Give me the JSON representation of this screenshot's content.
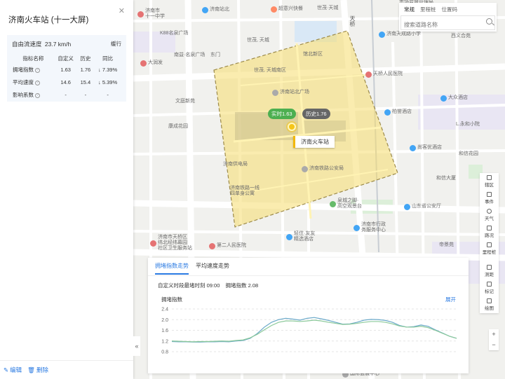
{
  "panel": {
    "title": "济南火车站 (十一大屏)",
    "free_flow_label": "自由流速度",
    "free_flow_value": "23.7 km/h",
    "slow_label": "缓行",
    "table": {
      "headers": [
        "指标名称",
        "自定义",
        "历史",
        "同比"
      ],
      "rows": [
        {
          "name": "拥堵指数",
          "custom": "1.63",
          "history": "1.76",
          "yoy": "↓ 7.39%"
        },
        {
          "name": "平均速度",
          "custom": "14.6",
          "history": "15.4",
          "yoy": "↓ 5.39%"
        },
        {
          "name": "影响系数",
          "custom": "-",
          "history": "-",
          "yoy": "-"
        }
      ]
    },
    "edit_label": "编辑",
    "delete_label": "删除"
  },
  "search": {
    "tabs": [
      "常规",
      "里程桩",
      "位置码"
    ],
    "placeholder": "搜索道路名称"
  },
  "map": {
    "road_labels": [
      "天桥"
    ],
    "pois": [
      {
        "name": "济南市\n十一中学",
        "color": "#e57373"
      },
      {
        "name": "济南站北",
        "color": "#42a5f5"
      },
      {
        "name": "超意兴快餐",
        "color": "#ff8a65"
      },
      {
        "name": "世茂·天城",
        "color": "#aaa"
      },
      {
        "name": "市场监督管理局",
        "color": "#aaa"
      },
      {
        "name": "济南天成路小学",
        "color": "#42a5f5"
      },
      {
        "name": "西义合苑",
        "color": "#aaa"
      },
      {
        "name": "K88名泉广场",
        "color": "#aaa"
      },
      {
        "name": "世茂, 天城",
        "color": "#aaa"
      },
      {
        "name": "馆北新区",
        "color": "#aaa"
      },
      {
        "name": "南益·名泉广场",
        "color": "#aaa"
      },
      {
        "name": "东门",
        "color": "#aaa"
      },
      {
        "name": "大润发",
        "color": "#e57373"
      },
      {
        "name": "世茂, 天城南区",
        "color": "#aaa"
      },
      {
        "name": "天桥人民医院",
        "color": "#e57373"
      },
      {
        "name": "济南站北广场",
        "color": "#aaa"
      },
      {
        "name": "大众酒店",
        "color": "#42a5f5"
      },
      {
        "name": "文庭新苑",
        "color": "#aaa"
      },
      {
        "name": "L.永和小院",
        "color": "#aaa"
      },
      {
        "name": "柏誉酒店",
        "color": "#42a5f5"
      },
      {
        "name": "康成花园",
        "color": "#aaa"
      },
      {
        "name": "尚客优酒店",
        "color": "#42a5f5"
      },
      {
        "name": "和信花园",
        "color": "#aaa"
      },
      {
        "name": "济南供电局",
        "color": "#aaa"
      },
      {
        "name": "济南铁路公安局",
        "color": "#aaa"
      },
      {
        "name": "和信大厦",
        "color": "#aaa"
      },
      {
        "name": "济南铁路一线\n四单身公寓",
        "color": "#aaa"
      },
      {
        "name": "泉城之脚·\n高空观景台",
        "color": "#66bb6a"
      },
      {
        "name": "山东省公安厅",
        "color": "#42a5f5"
      },
      {
        "name": "济南市行政\n务服务中心",
        "color": "#42a5f5"
      },
      {
        "name": "济南市天桥区\n纬北经纬幕园\n社区卫生服务站",
        "color": "#e57373"
      },
      {
        "name": "第二人民医院",
        "color": "#e57373"
      },
      {
        "name": "轻住·友友\n精选酒店",
        "color": "#42a5f5"
      },
      {
        "name": "帝景苑",
        "color": "#aaa"
      },
      {
        "name": "国际会展中心",
        "color": "#aaa"
      }
    ],
    "tag_now": "实时1.63",
    "tag_history": "历史1.76",
    "station_label": "济南火车站"
  },
  "toolbar": [
    {
      "label": "辖区",
      "icon": "boundary-icon"
    },
    {
      "label": "事件",
      "icon": "event-icon"
    },
    {
      "label": "天气",
      "icon": "weather-icon"
    },
    {
      "label": "路况",
      "icon": "traffic-icon"
    },
    {
      "label": "里程桩",
      "icon": "milestone-icon"
    },
    {
      "label": "测距",
      "icon": "ruler-icon"
    },
    {
      "label": "标记",
      "icon": "marker-icon"
    },
    {
      "label": "绘图",
      "icon": "draw-icon"
    }
  ],
  "chart_panel": {
    "tabs": [
      "拥堵指数走势",
      "平均速度走势"
    ],
    "info_label": "自定义时段最堵时刻",
    "info_time": "09:00",
    "info_index_label": "拥堵指数",
    "info_index_value": "2.08",
    "chart_title": "拥堵指数",
    "expand_label": "展开"
  },
  "chart_data": {
    "type": "line",
    "title": "拥堵指数",
    "ylabel": "",
    "ylim": [
      0.8,
      2.4
    ],
    "yticks": [
      "2.4",
      "2.0",
      "1.6",
      "1.2",
      "0.8"
    ],
    "grid": true,
    "x": [
      0,
      1,
      2,
      3,
      4,
      5,
      6,
      7,
      8,
      9,
      10,
      11,
      12,
      13,
      14,
      15,
      16,
      17,
      18,
      19,
      20,
      21,
      22,
      23,
      24,
      25,
      26,
      27,
      28,
      29,
      30,
      31,
      32,
      33,
      34,
      35,
      36,
      37,
      38,
      39,
      40
    ],
    "series": [
      {
        "color": "#6aa9c9",
        "values": [
          1.18,
          1.17,
          1.17,
          1.16,
          1.16,
          1.17,
          1.17,
          1.18,
          1.17,
          1.2,
          1.22,
          1.3,
          1.48,
          1.72,
          1.9,
          2.0,
          2.05,
          2.02,
          1.98,
          2.05,
          2.08,
          2.03,
          1.97,
          1.9,
          1.83,
          1.84,
          1.9,
          1.98,
          2.01,
          2.0,
          1.97,
          1.9,
          1.78,
          1.72,
          1.74,
          1.8,
          1.75,
          1.62,
          1.5,
          1.38,
          1.3
        ]
      },
      {
        "color": "#8bc99a",
        "values": [
          1.2,
          1.19,
          1.18,
          1.17,
          1.18,
          1.18,
          1.19,
          1.2,
          1.19,
          1.22,
          1.24,
          1.32,
          1.45,
          1.62,
          1.78,
          1.9,
          1.95,
          1.95,
          1.93,
          1.95,
          1.98,
          1.95,
          1.9,
          1.86,
          1.82,
          1.83,
          1.86,
          1.9,
          1.93,
          1.93,
          1.9,
          1.84,
          1.76,
          1.72,
          1.72,
          1.75,
          1.7,
          1.6,
          1.49,
          1.38,
          1.3
        ]
      }
    ]
  }
}
